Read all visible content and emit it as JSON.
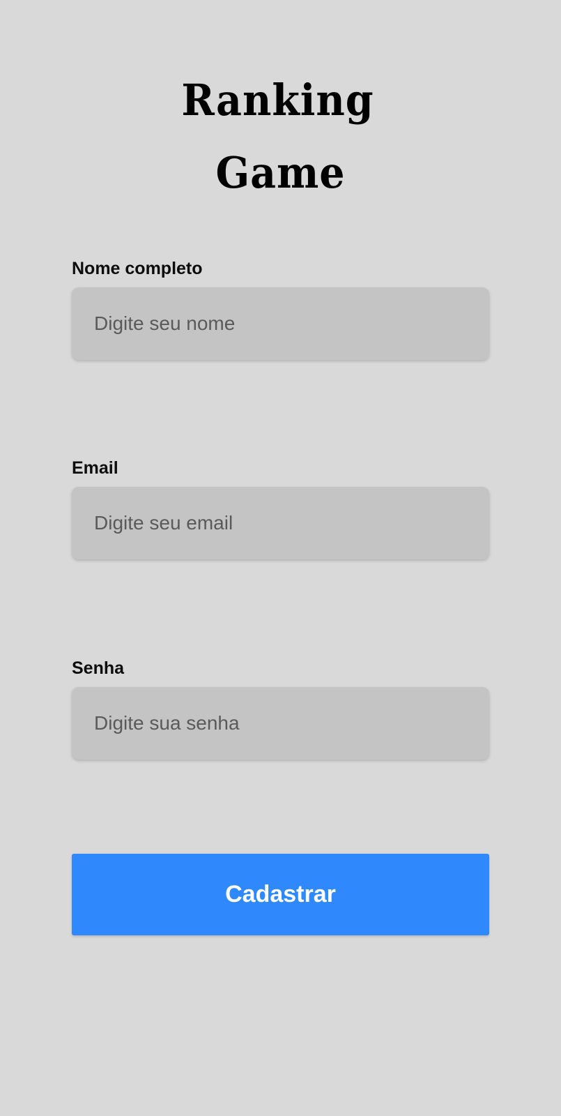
{
  "logo": {
    "line1": "Ranking",
    "line2": "Game"
  },
  "form": {
    "name": {
      "label": "Nome completo",
      "placeholder": "Digite seu nome",
      "value": ""
    },
    "email": {
      "label": "Email",
      "placeholder": "Digite seu email",
      "value": ""
    },
    "password": {
      "label": "Senha",
      "placeholder": "Digite sua senha",
      "value": ""
    },
    "submit_label": "Cadastrar"
  },
  "colors": {
    "background": "#d9d9d9",
    "input_background": "#c4c4c4",
    "button": "#2f89fc",
    "button_text": "#ffffff"
  }
}
